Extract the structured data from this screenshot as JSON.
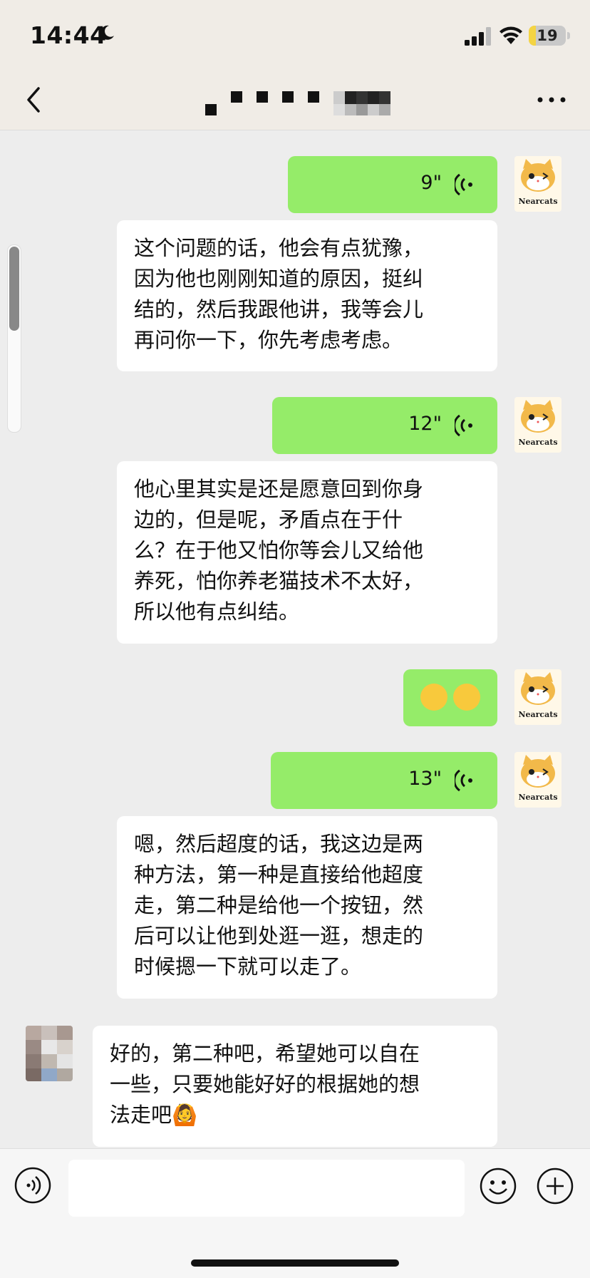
{
  "status_bar": {
    "time": "14:44",
    "battery": "19",
    "battery_level": 0.19
  },
  "nav": {
    "title_obscured": true
  },
  "contact_avatar": {
    "logo_text": "Nearcats"
  },
  "messages": [
    {
      "type": "voice",
      "from": "self",
      "duration": "9\""
    },
    {
      "type": "text",
      "from": "self",
      "text": "这个问题的话，他会有点犹豫，\n因为他也刚刚知道的原因，挺纠\n结的，然后我跟他讲，我等会儿\n再问你一下，你先考虑考虑。"
    },
    {
      "type": "voice",
      "from": "self",
      "duration": "12\""
    },
    {
      "type": "text",
      "from": "self",
      "text": "他心里其实是还是愿意回到你身\n边的，但是呢，矛盾点在于什\n么？在于他又怕你等会儿又给他\n养死，怕你养老猫技术不太好，\n所以他有点纠结。"
    },
    {
      "type": "emoji",
      "from": "self",
      "emoji": "😂😂"
    },
    {
      "type": "voice",
      "from": "self",
      "duration": "13\""
    },
    {
      "type": "text",
      "from": "self",
      "text": "嗯，然后超度的话，我这边是两\n种方法，第一种是直接给他超度\n走，第二种是给他一个按钮，然\n后可以让他到处逛一逛，想走的\n时候摁一下就可以走了。"
    },
    {
      "type": "text",
      "from": "other",
      "text": "好的，第二种吧，希望她可以自在\n一些，只要她能好好的根据她的想\n法走吧🙆"
    }
  ],
  "colors": {
    "self_bubble": "#95ec69",
    "other_bubble": "#ffffff",
    "background": "#ededed"
  },
  "icons": [
    "moon-icon",
    "signal-icon",
    "wifi-icon",
    "back-icon",
    "more-icon",
    "voice-wave-icon",
    "voice-input-icon",
    "emoji-icon",
    "plus-icon"
  ]
}
